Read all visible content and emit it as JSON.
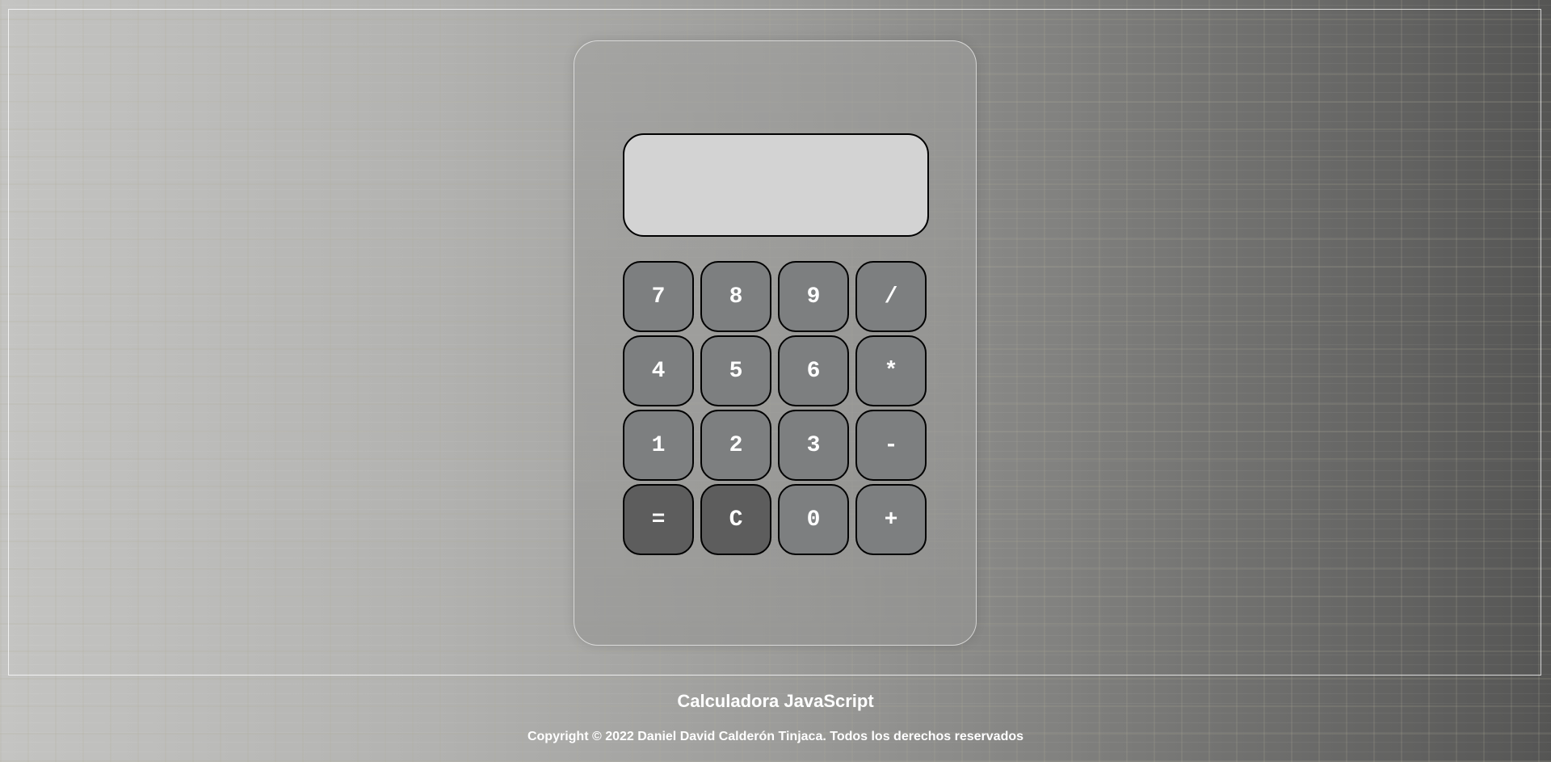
{
  "app": {
    "title": "Calculadora JavaScript",
    "copyright": "Copyright © 2022 Daniel David Calderón Tinjaca. Todos los derechos reservados"
  },
  "display": {
    "value": ""
  },
  "keys": [
    {
      "label": "7",
      "name": "key-7",
      "style": "normal"
    },
    {
      "label": "8",
      "name": "key-8",
      "style": "normal"
    },
    {
      "label": "9",
      "name": "key-9",
      "style": "normal"
    },
    {
      "label": "/",
      "name": "key-divide",
      "style": "normal"
    },
    {
      "label": "4",
      "name": "key-4",
      "style": "normal"
    },
    {
      "label": "5",
      "name": "key-5",
      "style": "normal"
    },
    {
      "label": "6",
      "name": "key-6",
      "style": "normal"
    },
    {
      "label": "*",
      "name": "key-multiply",
      "style": "normal"
    },
    {
      "label": "1",
      "name": "key-1",
      "style": "normal"
    },
    {
      "label": "2",
      "name": "key-2",
      "style": "normal"
    },
    {
      "label": "3",
      "name": "key-3",
      "style": "normal"
    },
    {
      "label": "-",
      "name": "key-subtract",
      "style": "normal"
    },
    {
      "label": "=",
      "name": "key-equals",
      "style": "dark"
    },
    {
      "label": "C",
      "name": "key-clear",
      "style": "dark"
    },
    {
      "label": "0",
      "name": "key-0",
      "style": "normal"
    },
    {
      "label": "+",
      "name": "key-add",
      "style": "normal"
    }
  ],
  "colors": {
    "key_background": "#7d7f80",
    "key_dark_background": "#5d5d5d",
    "display_background": "#d3d3d3",
    "key_text": "#ffffff"
  }
}
